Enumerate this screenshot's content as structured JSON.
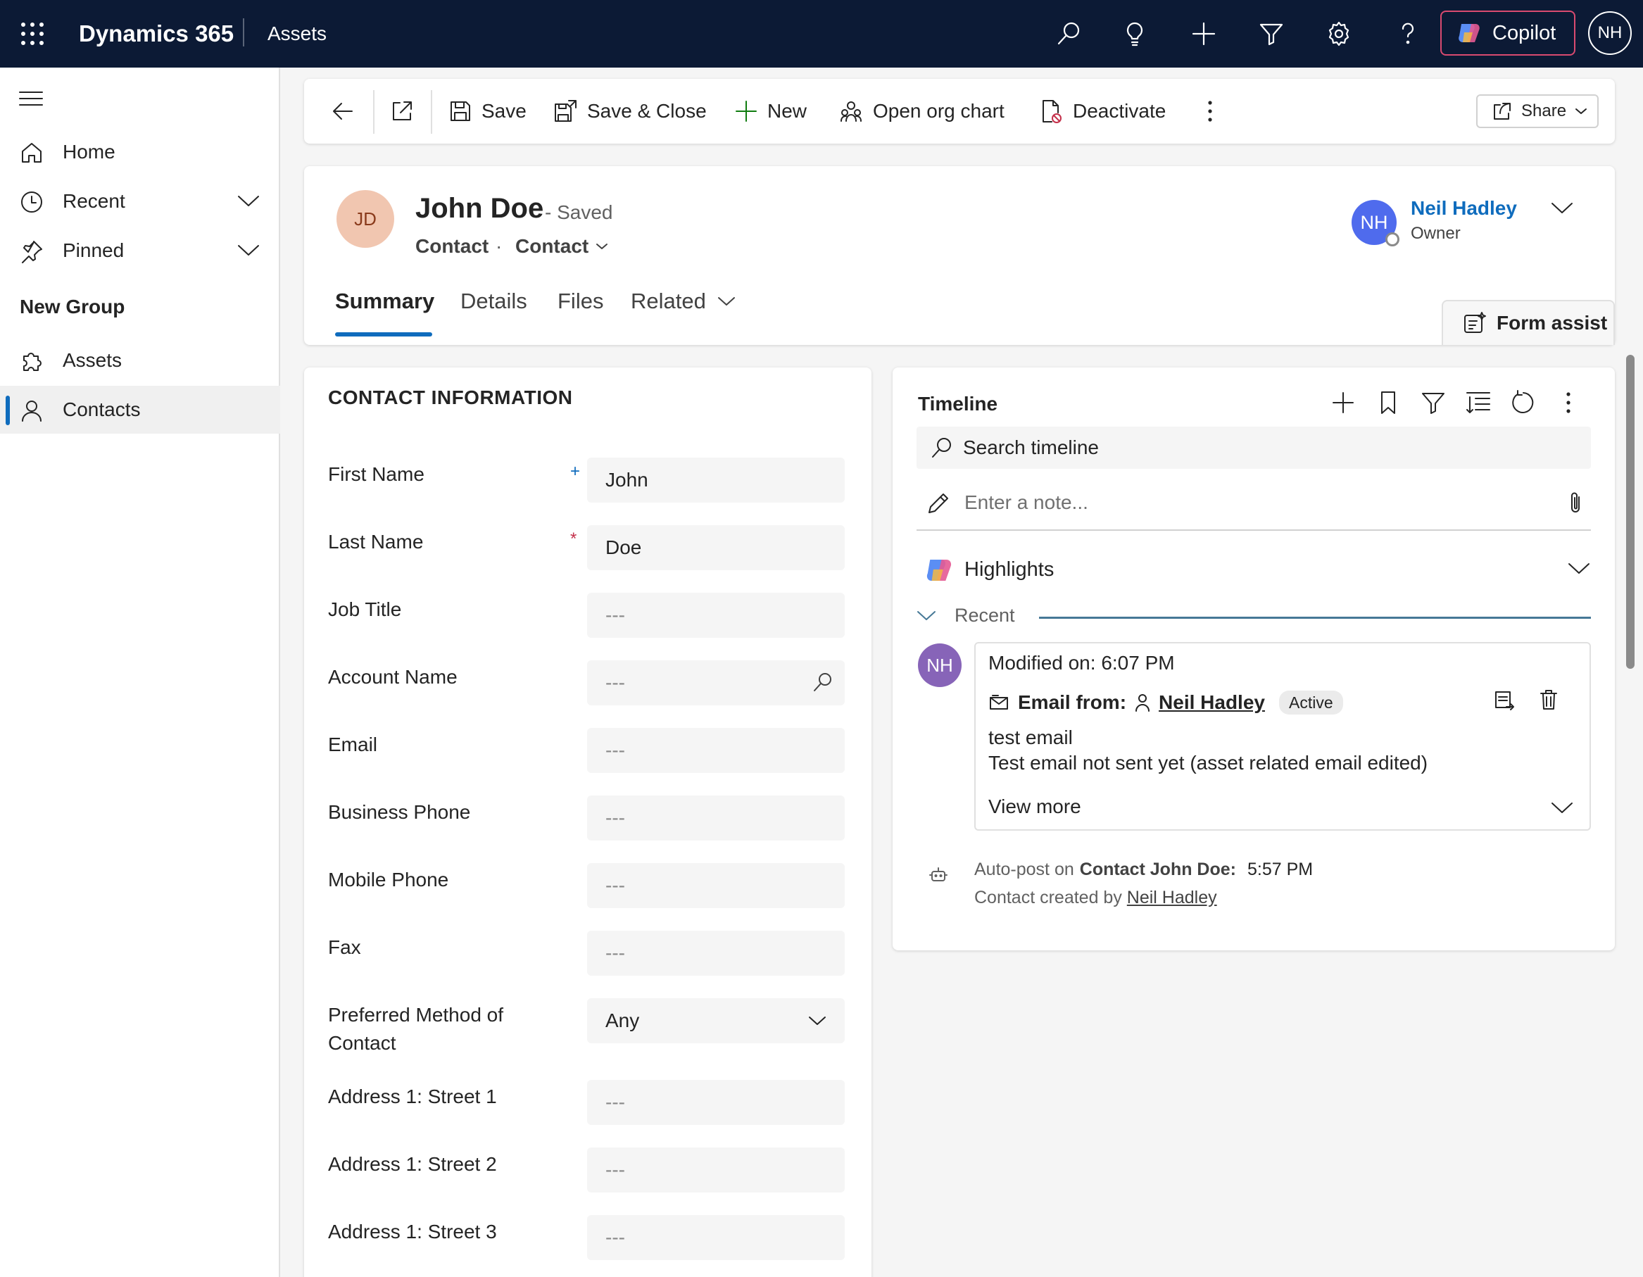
{
  "app": {
    "name": "Dynamics 365",
    "area": "Assets",
    "copilot_label": "Copilot",
    "user_initials": "NH"
  },
  "sidebar": {
    "items": [
      {
        "label": "Home",
        "icon": "home-icon"
      },
      {
        "label": "Recent",
        "icon": "clock-icon"
      },
      {
        "label": "Pinned",
        "icon": "pin-icon"
      }
    ],
    "group_label": "New Group",
    "group_items": [
      {
        "label": "Assets",
        "icon": "puzzle-icon"
      },
      {
        "label": "Contacts",
        "icon": "person-icon",
        "active": true
      }
    ]
  },
  "commands": {
    "save": "Save",
    "save_close": "Save & Close",
    "new": "New",
    "org_chart": "Open org chart",
    "deactivate": "Deactivate",
    "share": "Share"
  },
  "record": {
    "initials": "JD",
    "name": "John Doe",
    "status": "- Saved",
    "entity": "Contact",
    "dot": "·",
    "form": "Contact",
    "owner_initials": "NH",
    "owner_name": "Neil Hadley",
    "owner_role": "Owner"
  },
  "tabs": [
    "Summary",
    "Details",
    "Files",
    "Related"
  ],
  "form_assist": "Form assist",
  "contact_section": {
    "title": "CONTACT INFORMATION",
    "fields": [
      {
        "label": "First Name",
        "value": "John",
        "required": "+"
      },
      {
        "label": "Last Name",
        "value": "Doe",
        "required": "*"
      },
      {
        "label": "Job Title",
        "value": "---"
      },
      {
        "label": "Account Name",
        "value": "---"
      },
      {
        "label": "Email",
        "value": "---"
      },
      {
        "label": "Business Phone",
        "value": "---"
      },
      {
        "label": "Mobile Phone",
        "value": "---"
      },
      {
        "label": "Fax",
        "value": "---"
      },
      {
        "label": "Preferred Method of Contact",
        "value": "Any"
      },
      {
        "label": "Address 1: Street 1",
        "value": "---"
      },
      {
        "label": "Address 1: Street 2",
        "value": "---"
      },
      {
        "label": "Address 1: Street 3",
        "value": "---"
      }
    ]
  },
  "timeline": {
    "title": "Timeline",
    "search_placeholder": "Search timeline",
    "note_placeholder": "Enter a note...",
    "highlights": "Highlights",
    "recent": "Recent",
    "activity": {
      "initials": "NH",
      "modified": "Modified on: 6:07 PM",
      "email_from_label": "Email from:",
      "from_name": "Neil Hadley",
      "badge": "Active",
      "subject": "test email",
      "body": "Test email not sent yet (asset related email edited)",
      "view_more": "View more"
    },
    "autopost": {
      "prefix": "Auto-post on",
      "entity": "Contact John Doe:",
      "time": "5:57 PM",
      "created_prefix": "Contact created by",
      "created_by": "Neil Hadley"
    }
  },
  "colors": {
    "topbar": "#0c1a35",
    "accent": "#0f6cbd",
    "required": "#c4314b",
    "copilot_border": "#d94a70"
  }
}
